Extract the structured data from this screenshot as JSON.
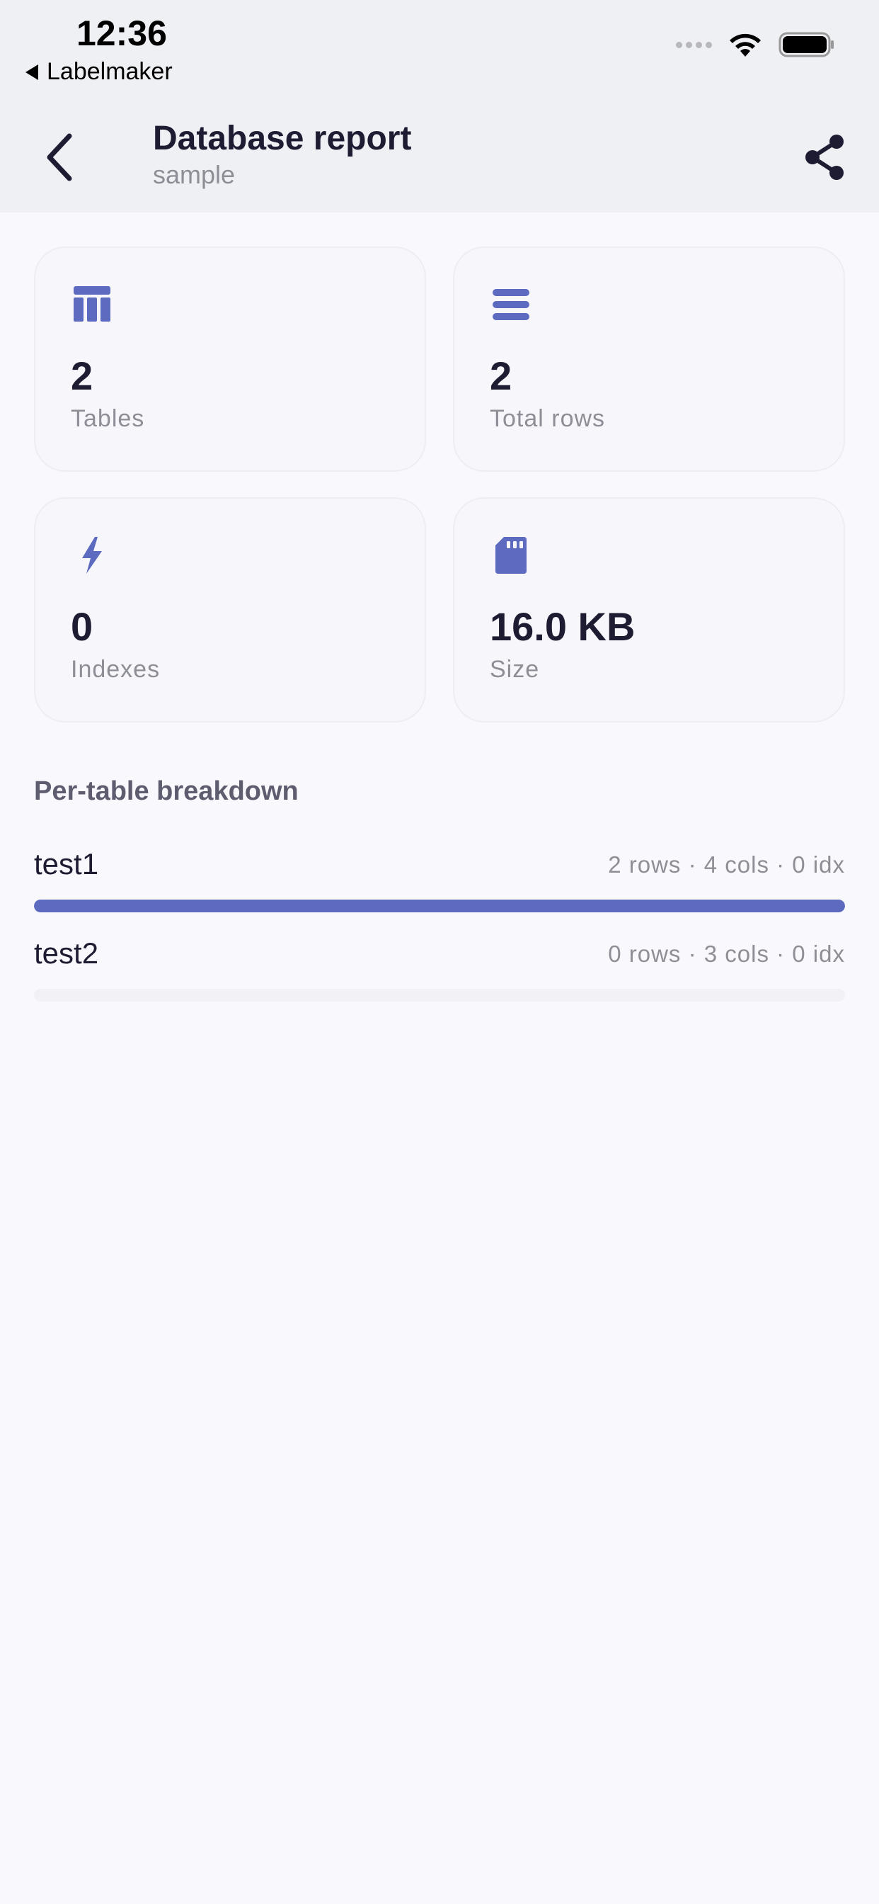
{
  "status_bar": {
    "time": "12:36",
    "back_app": "Labelmaker"
  },
  "nav": {
    "title": "Database report",
    "subtitle": "sample"
  },
  "accent_color": "#5c6bc0",
  "stats": {
    "tables": {
      "value": "2",
      "label": "Tables",
      "icon": "table-icon"
    },
    "rows": {
      "value": "2",
      "label": "Total rows",
      "icon": "rows-icon"
    },
    "indexes": {
      "value": "0",
      "label": "Indexes",
      "icon": "bolt-icon"
    },
    "size": {
      "value": "16.0 KB",
      "label": "Size",
      "icon": "sd-card-icon"
    }
  },
  "breakdown": {
    "title": "Per-table breakdown",
    "tables": [
      {
        "name": "test1",
        "meta": "2 rows · 4 cols · 0 idx",
        "fill_fraction": 1.0
      },
      {
        "name": "test2",
        "meta": "0 rows · 3 cols · 0 idx",
        "fill_fraction": 0.0
      }
    ]
  }
}
